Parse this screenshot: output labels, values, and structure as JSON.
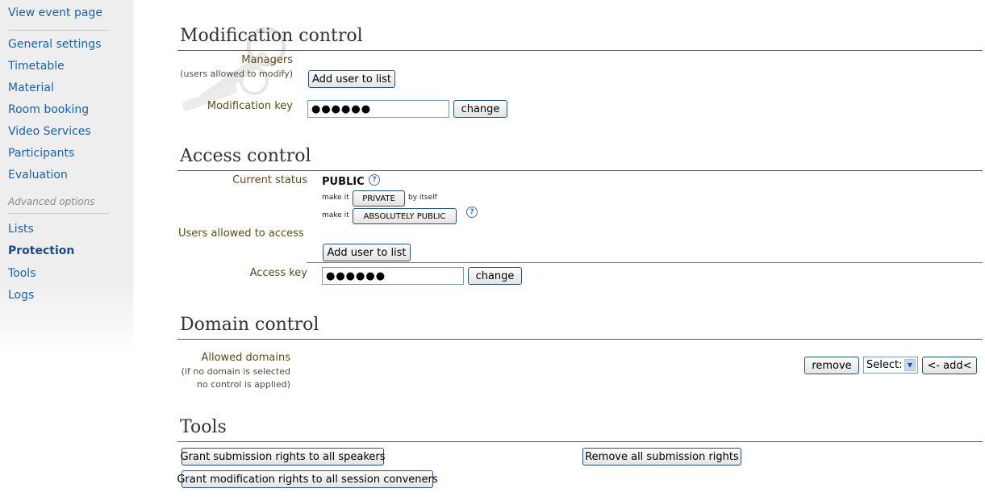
{
  "sidebar": {
    "items": [
      {
        "label": "View event page"
      },
      {
        "label": "General settings"
      },
      {
        "label": "Timetable"
      },
      {
        "label": "Material"
      },
      {
        "label": "Room booking"
      },
      {
        "label": "Video Services"
      },
      {
        "label": "Participants"
      },
      {
        "label": "Evaluation"
      }
    ],
    "advanced_heading": "Advanced options",
    "advanced_items": [
      {
        "label": "Lists"
      },
      {
        "label": "Protection"
      },
      {
        "label": "Tools"
      },
      {
        "label": "Logs"
      }
    ],
    "active_item": "Protection"
  },
  "modification": {
    "title": "Modification control",
    "managers_label": "Managers",
    "managers_sub": "(users allowed to modify)",
    "add_user_label": "Add user to list",
    "key_label": "Modification key",
    "key_value": "●●●●●●",
    "change_label": "change"
  },
  "access": {
    "title": "Access control",
    "status_label": "Current status",
    "status_value": "PUBLIC",
    "make_it_1": "make it",
    "private_label": "PRIVATE",
    "by_itself": "by itself",
    "make_it_2": "make it",
    "absolutely_public_label": "ABSOLUTELY PUBLIC",
    "users_allowed_label": "Users allowed to access",
    "add_user_label": "Add user to list",
    "key_label": "Access key",
    "key_value": "●●●●●●",
    "change_label": "change"
  },
  "domain": {
    "title": "Domain control",
    "allowed_label": "Allowed domains",
    "note_line1": "(if no domain is selected",
    "note_line2": "no control is applied)",
    "remove_label": "remove",
    "select_value": "Select:",
    "add_label": "<- add<"
  },
  "tools": {
    "title": "Tools",
    "grant_submission_label": "Grant submission rights to all speakers",
    "remove_submission_label": "Remove all submission rights",
    "grant_modification_label": "Grant modification rights to all session conveners"
  },
  "icons": {
    "help": "help-icon",
    "background": "key-watermark-icon"
  },
  "colors": {
    "link": "#1a62a6",
    "active_link": "#1f4c85",
    "label": "#5a4a1a"
  }
}
